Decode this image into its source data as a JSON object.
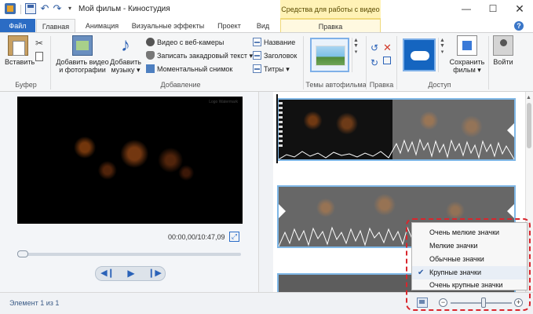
{
  "window": {
    "title": "Мой фильм - Киностудия",
    "context_tab_header": "Средства для работы с видео",
    "minimize_glyph": "—",
    "maximize_glyph": "☐",
    "close_glyph": "✕"
  },
  "tabs": {
    "file": "Файл",
    "home": "Главная",
    "animation": "Анимация",
    "visual_effects": "Визуальные эффекты",
    "project": "Проект",
    "view": "Вид",
    "edit": "Правка",
    "help": "?"
  },
  "ribbon": {
    "clipboard": {
      "paste": "Вставить",
      "group": "Буфер"
    },
    "add": {
      "add_video_line1": "Добавить видео",
      "add_video_line2": "и фотографии",
      "add_music_line1": "Добавить",
      "add_music_line2": "музыку ▾",
      "webcam": "Видео с веб-камеры",
      "narration": "Записать закадровый текст ▾",
      "snapshot": "Моментальный снимок",
      "title": "Название",
      "caption": "Заголовок",
      "credits": "Титры ▾",
      "group": "Добавление"
    },
    "themes": {
      "group": "Темы автофильма"
    },
    "editing": {
      "group": "Правка"
    },
    "share": {
      "save_line1": "Сохранить",
      "save_line2": "фильм ▾",
      "group": "Доступ"
    },
    "signin": {
      "label": "Войти"
    }
  },
  "preview": {
    "watermark": "Logo\nWatermark",
    "time": "00:00,00/10:47,09",
    "progress": 0,
    "duration_total": "10:47,09"
  },
  "status": {
    "element_count": "Элемент 1 из 1",
    "zoom_level": 0.5
  },
  "thumbnail_menu": {
    "items": [
      {
        "label": "Очень мелкие значки",
        "checked": false
      },
      {
        "label": "Мелкие значки",
        "checked": false
      },
      {
        "label": "Обычные значки",
        "checked": false
      },
      {
        "label": "Крупные значки",
        "checked": true
      },
      {
        "label": "Очень крупные значки",
        "checked": false
      }
    ],
    "check_glyph": "✔"
  },
  "colors": {
    "file_tab": "#2b6cc4",
    "context_tab": "#fff2b6",
    "clip_border": "#7fb7e6",
    "highlight": "#d9262d"
  }
}
